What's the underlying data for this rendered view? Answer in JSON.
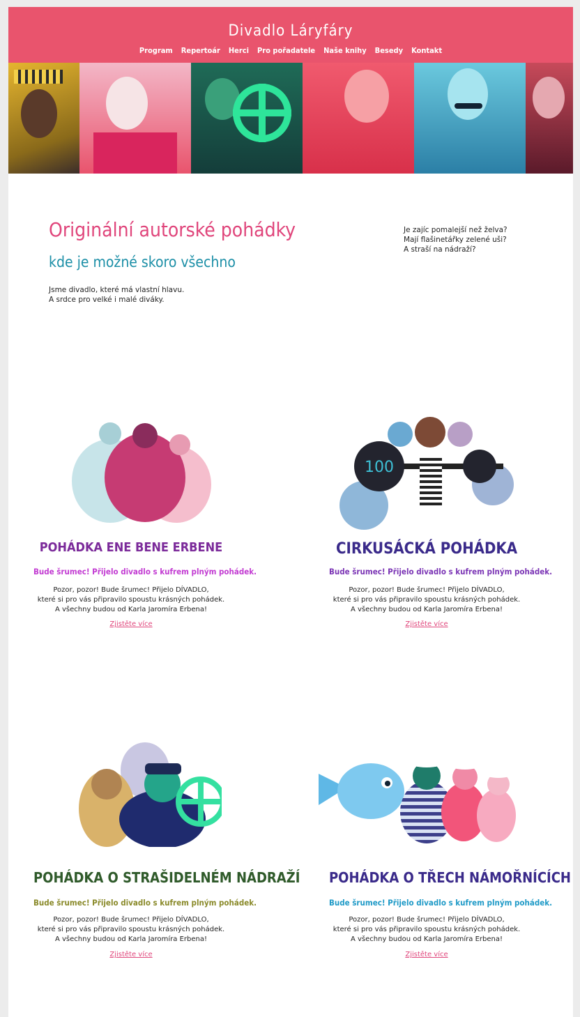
{
  "header": {
    "title": "Divadlo Láryfáry",
    "nav": [
      "Program",
      "Repertoár",
      "Herci",
      "Pro pořadatele",
      "Naše knihy",
      "Besedy",
      "Kontakt"
    ]
  },
  "intro": {
    "heading": "Originální autorské pohádky",
    "subheading": "kde je možné skoro všechno",
    "text": [
      "Jsme divadlo, které má vlastní hlavu.",
      "A srdce pro velké i malé diváky."
    ],
    "side_text": [
      "Je zajíc pomalejší než želva?",
      "Mají flašinetářky zelené uši?",
      "A straší na nádraží?"
    ]
  },
  "cards": [
    {
      "title": "POHÁDKA ENE BENE ERBENE",
      "tagline": "Bude šrumec! Přijelo divadlo s kufrem plným pohádek.",
      "desc": [
        "Pozor, pozor! Bude šrumec! Přijelo DÍVADLO,",
        "které si pro vás připravilo spoustu krásných pohádek.",
        "A všechny budou od Karla Jaromíra Erbena!"
      ],
      "more": "Zjistěte více",
      "title_color": "#7b2a9a",
      "tag_color": "#c23bd2"
    },
    {
      "title": "CIRKUSÁCKÁ POHÁDKA",
      "tagline": "Bude šrumec! Přijelo divadlo s kufrem plným pohádek.",
      "desc": [
        "Pozor, pozor! Bude šrumec! Přijelo DÍVADLO,",
        "které si pro vás připravilo spoustu krásných pohádek.",
        "A všechny budou od Karla Jaromíra Erbena!"
      ],
      "more": "Zjistěte více",
      "title_color": "#3a2a8a",
      "tag_color": "#7b35b5"
    },
    {
      "title": "POHÁDKA O STRAŠIDELNÉM NÁDRAŽÍ",
      "tagline": "Bude šrumec! Přijelo divadlo s kufrem plným pohádek.",
      "desc": [
        "Pozor, pozor! Bude šrumec! Přijelo DÍVADLO,",
        "které si pro vás připravilo spoustu krásných pohádek.",
        "A všechny budou od Karla Jaromíra Erbena!"
      ],
      "more": "Zjistěte více",
      "title_color": "#2f5a2a",
      "tag_color": "#8a8a2a"
    },
    {
      "title": "POHÁDKA O TŘECH NÁMOŘNÍCÍCH",
      "tagline": "Bude šrumec! Přijelo divadlo s kufrem plným pohádek.",
      "desc": [
        "Pozor, pozor! Bude šrumec! Přijelo DÍVADLO,",
        "které si pro vás připravilo spoustu krásných pohádek.",
        "A všechny budou od Karla Jaromíra Erbena!"
      ],
      "more": "Zjistěte více",
      "title_color": "#3a2a8a",
      "tag_color": "#1f9ac7"
    }
  ],
  "colors": {
    "header": "#e9546d",
    "accent": "#e0457b",
    "teal": "#1a8ea6"
  }
}
